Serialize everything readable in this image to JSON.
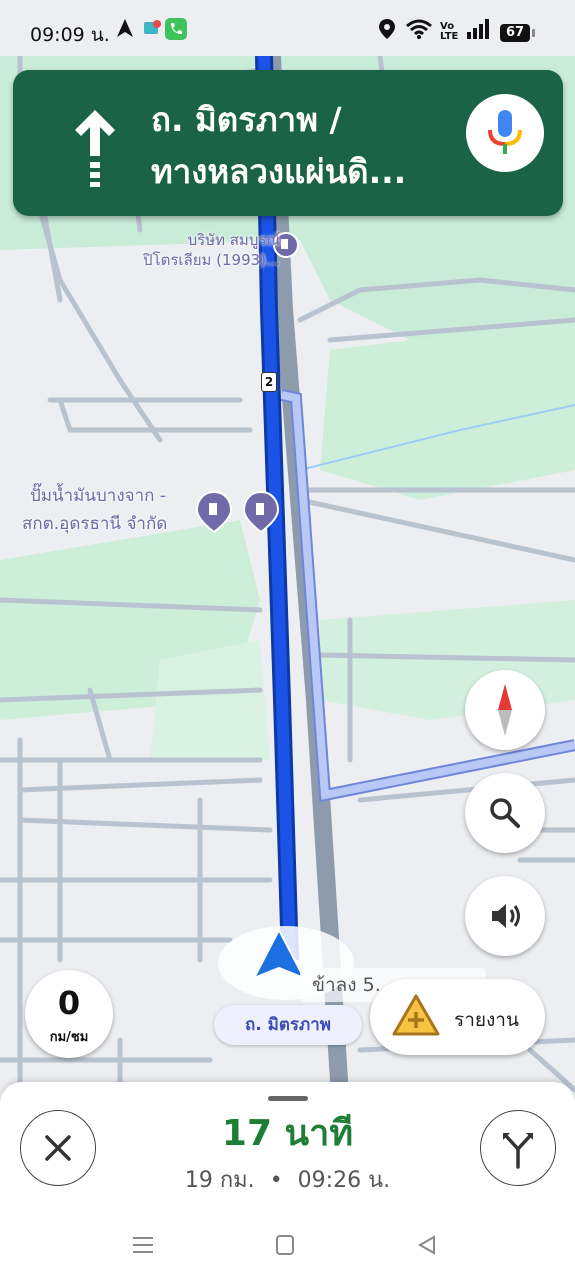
{
  "status_bar": {
    "time": "09:09 น.",
    "battery": "67",
    "icons": [
      "navigation-arrow-icon",
      "app-icon",
      "phone-icon",
      "location-icon",
      "wifi-icon",
      "volte-icon",
      "signal-icon",
      "battery-icon"
    ]
  },
  "banner": {
    "street_line1": "ถ. มิตรภาพ /",
    "street_line2": "ทางหลวงแผ่นดิ...",
    "maneuver_icon": "straight-arrow-icon",
    "mic_icon": "mic-icon"
  },
  "map": {
    "poi_gas_1": "บริษัท สมบูรณ์\nปิโตรเลียม (1993)...",
    "poi_gas_2_line1": "ปั๊มน้ำมันบางจาก -",
    "poi_gas_2_line2": "สกต.อุดรธานี จำกัด",
    "road_shield": "2",
    "street_chip": "ถ. มิตรภาพ",
    "partial_label": "ข้าลง 5..."
  },
  "speed": {
    "value": "0",
    "unit": "กม/ชม"
  },
  "report": {
    "label": "รายงาน"
  },
  "trip": {
    "eta_minutes": "17",
    "eta_unit": "นาที",
    "distance": "19 กม.",
    "separator": "•",
    "arrival": "09:26 น."
  },
  "colors": {
    "banner": "#1b6346",
    "route": "#1a53e6",
    "eta": "#1e7e34",
    "poi": "#7169a8"
  }
}
